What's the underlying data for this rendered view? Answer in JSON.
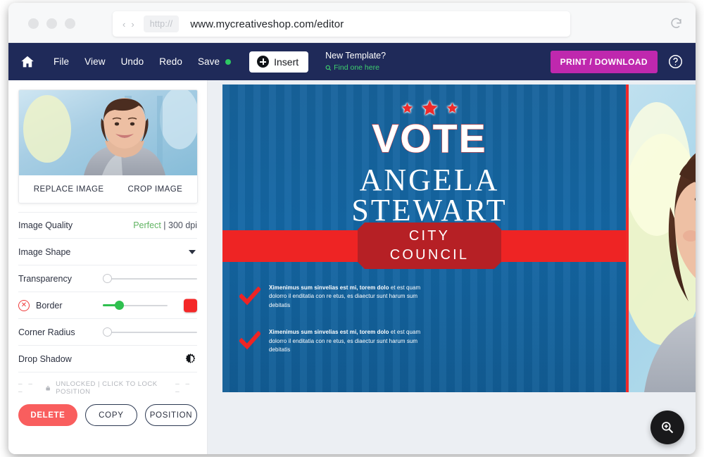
{
  "browser": {
    "back_icon": "chevron-left-icon",
    "forward_icon": "chevron-right-icon",
    "scheme_label": "http://",
    "url": "www.mycreativeshop.com/editor",
    "reload_icon": "reload-icon"
  },
  "toolbar": {
    "home_icon": "home-icon",
    "menu": [
      {
        "label": "File"
      },
      {
        "label": "View"
      },
      {
        "label": "Undo"
      },
      {
        "label": "Redo"
      }
    ],
    "save_label": "Save",
    "save_status_color": "#2ec963",
    "insert_label": "Insert",
    "insert_icon": "plus-circle-icon",
    "new_template_title": "New Template?",
    "new_template_link": "Find one here",
    "new_template_link_icon": "search-icon",
    "print_label": "PRINT / DOWNLOAD",
    "print_color": "#bf28ae",
    "help_icon": "question-mark-circle-icon"
  },
  "sidebar": {
    "thumbnail": {
      "replace_label": "REPLACE IMAGE",
      "crop_label": "CROP IMAGE"
    },
    "properties": [
      {
        "label": "Image Quality",
        "value_good": "Perfect",
        "value_rest": " | 300 dpi"
      },
      {
        "label": "Image Shape",
        "control": "dropdown"
      },
      {
        "label": "Transparency",
        "control": "slider",
        "value": 0
      },
      {
        "label": "Border",
        "control": "slider-color",
        "value": 20,
        "color": "#f42727",
        "toggle_icon": "close-circle-icon"
      },
      {
        "label": "Corner Radius",
        "control": "slider",
        "value": 0
      },
      {
        "label": "Drop Shadow",
        "control": "icon-toggle",
        "icon": "contrast-icon"
      }
    ],
    "lock_row": {
      "dash_left": "–  –  –",
      "dash_right": "–  –  –",
      "lock_icon": "lock-icon",
      "label": "UNLOCKED | CLICK TO LOCK POSITION"
    },
    "actions": [
      {
        "label": "DELETE",
        "style": "danger"
      },
      {
        "label": "COPY",
        "style": "outline"
      },
      {
        "label": "POSITION",
        "style": "outline"
      }
    ]
  },
  "canvas": {
    "poster": {
      "background_color": "#1464a0",
      "stars_count": 3,
      "star_color": "#ee2b2b",
      "headline": "VOTE",
      "name_line_1": "ANGELA",
      "name_line_2": "STEWART",
      "band_color": "#ee2424",
      "badge_line_1": "CITY",
      "badge_line_2": "COUNCIL",
      "badge_color": "#b62025",
      "bullets": [
        {
          "check_icon": "checkmark-icon",
          "bold_lead": "Ximenimus sum sinvelias est mi, torem dolo",
          "rest": " et est quam dolorro il enditatia con re etus, es diaectur sunt harum sum debitatis"
        },
        {
          "check_icon": "checkmark-icon",
          "bold_lead": "Ximenimus sum sinvelias est mi, torem dolo",
          "rest": " et est quam dolorro il enditatia con re etus, es diaectur sunt harum sum debitatis"
        }
      ]
    },
    "selected_element": {
      "type": "image",
      "border_color": "#f02a2a"
    },
    "zoom_button_icon": "magnifier-plus-icon"
  }
}
